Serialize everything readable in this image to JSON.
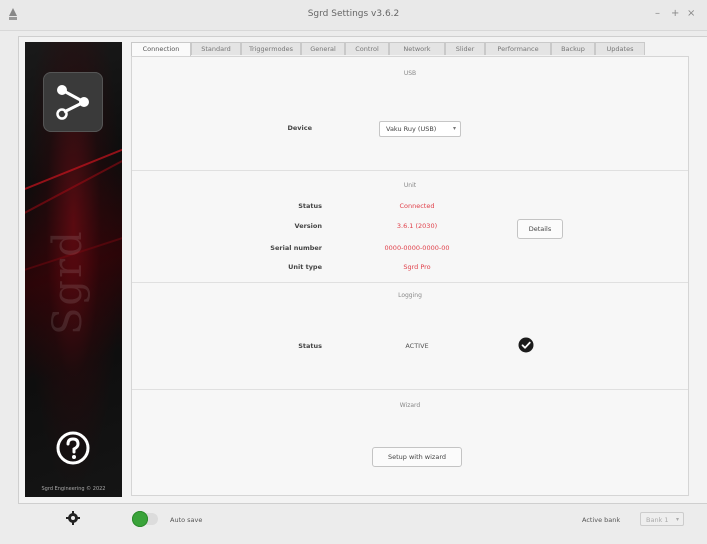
{
  "window": {
    "title": "Sgrd Settings v3.6.2",
    "controls": {
      "minimize": "–",
      "maximize": "+",
      "close": "×"
    }
  },
  "sidebar": {
    "brand": "Sgrd",
    "copyright": "Sgrd Engineering © 2022"
  },
  "tabs": [
    {
      "label": "Connection",
      "active": true
    },
    {
      "label": "Standard",
      "active": false
    },
    {
      "label": "Triggermodes",
      "active": false
    },
    {
      "label": "General",
      "active": false
    },
    {
      "label": "Control",
      "active": false
    },
    {
      "label": "Network",
      "active": false
    },
    {
      "label": "Slider",
      "active": false
    },
    {
      "label": "Performance",
      "active": false
    },
    {
      "label": "Backup",
      "active": false
    },
    {
      "label": "Updates",
      "active": false
    }
  ],
  "usb": {
    "title": "USB",
    "device_label": "Device",
    "device_value": "Vaku Ruy (USB)"
  },
  "unit": {
    "title": "Unit",
    "status_label": "Status",
    "status_value": "Connected",
    "version_label": "Version",
    "version_value": "3.6.1 (2030)",
    "serial_label": "Serial number",
    "serial_value": "0000-0000-0000-00",
    "unit_type_label": "Unit type",
    "unit_type_value": "Sgrd Pro",
    "details_button": "Details"
  },
  "logging": {
    "title": "Logging",
    "status_label": "Status",
    "status_value": "ACTIVE"
  },
  "wizard": {
    "title": "Wizard",
    "setup_button": "Setup with wizard"
  },
  "bottom": {
    "autosave_label": "Auto save",
    "active_bank_label": "Active bank",
    "active_bank_value": "Bank 1"
  },
  "colors": {
    "accent_red": "#e0404a",
    "toggle_green": "#3aa33a"
  }
}
